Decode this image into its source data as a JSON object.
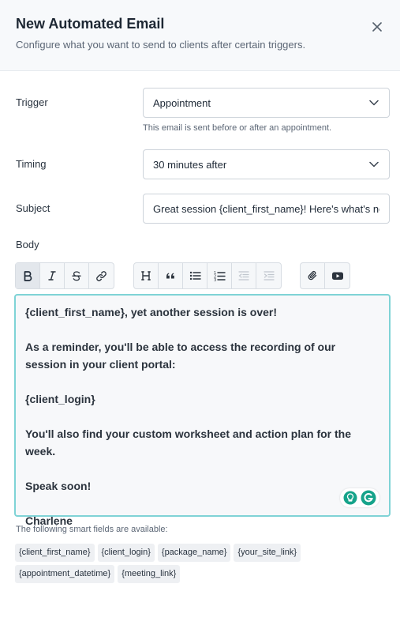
{
  "header": {
    "title": "New Automated Email",
    "subtitle": "Configure what you want to send to clients after certain triggers."
  },
  "form": {
    "trigger": {
      "label": "Trigger",
      "value": "Appointment",
      "hint": "This email is sent before or after an appointment."
    },
    "timing": {
      "label": "Timing",
      "value": "30 minutes after"
    },
    "subject": {
      "label": "Subject",
      "value": "Great session {client_first_name}! Here's what's next"
    },
    "body_label": "Body"
  },
  "toolbar": {
    "buttons": [
      "bold-icon",
      "italic-icon",
      "strikethrough-icon",
      "link-icon",
      "heading-icon",
      "quote-icon",
      "bulleted-list-icon",
      "numbered-list-icon",
      "outdent-icon",
      "indent-icon",
      "attachment-icon",
      "video-icon"
    ]
  },
  "editor": {
    "lines": [
      "{client_first_name}, yet another session is over!",
      "As a reminder, you'll be able to access the recording of our session in your client portal:",
      "{client_login}",
      "You'll also find your custom worksheet and action plan for the week.",
      "Speak soon!",
      "Charlene"
    ]
  },
  "smart_fields": {
    "title": "The following smart fields are available:",
    "items": [
      "{client_first_name}",
      "{client_login}",
      "{package_name}",
      "{your_site_link}",
      "{appointment_datetime}",
      "{meeting_link}"
    ]
  },
  "colors": {
    "focus_border": "#7fd3d6",
    "grammarly": "#15a38a"
  }
}
